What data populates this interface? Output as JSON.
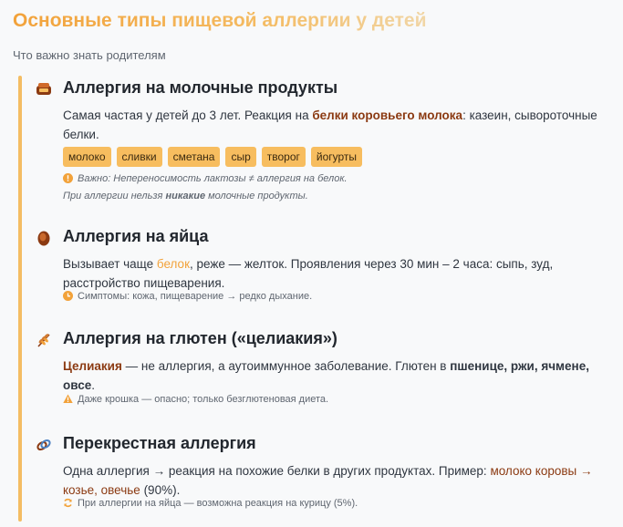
{
  "header": {
    "title": "Основные типы пищевой аллергии у детей",
    "subtitle": "Что важно знать родителям"
  },
  "sections": [
    {
      "icon": "milk-bottle-icon",
      "title": "Аллергия на молочные продукты",
      "text_a": "Самая частая у детей до 3 лет. Реакция на ",
      "text_hl": "белки коровьего молока",
      "text_b": ": казеин, сывороточные белки.",
      "tags": [
        "молоко",
        "сливки",
        "сметана",
        "сыр",
        "творог",
        "йогурты"
      ],
      "note_1": "Важно: Непереносимость лактозы ≠ аллергия на белок.",
      "note_2a": "При аллергии нельзя ",
      "note_2b": "никакие",
      "note_2c": " молочные продукты."
    },
    {
      "icon": "egg-icon",
      "title": "Аллергия на яйца",
      "text_a": "Вызывает чаще ",
      "text_hl": "белок",
      "text_b": ", реже — желток. Проявления через 30 мин – 2 часа: сыпь, зуд, расстройство пищеварения.",
      "note": "Симптомы: кожа, пищеварение → редко дыхание."
    },
    {
      "icon": "wheat-icon",
      "title": "Аллергия на глютен («целиакия»)",
      "text_hl": "Целиакия",
      "text_a": " — не аллергия, а аутоиммунное заболевание. Глютен в ",
      "text_bold": "пшенице, ржи, ячмене, овсе",
      "text_b": ".",
      "note": "Даже крошка — опасно; только безглютеновая диета."
    },
    {
      "icon": "link-icon",
      "title": "Перекрестная аллергия",
      "text_a": "Одна аллергия → реакция на похожие белки в других продуктах. Пример: ",
      "text_hl": "молоко коровы → козье, овечье",
      "text_b": " (90%).",
      "note": "При аллергии на яйца — возможна реакция на курицу (5%)."
    }
  ]
}
